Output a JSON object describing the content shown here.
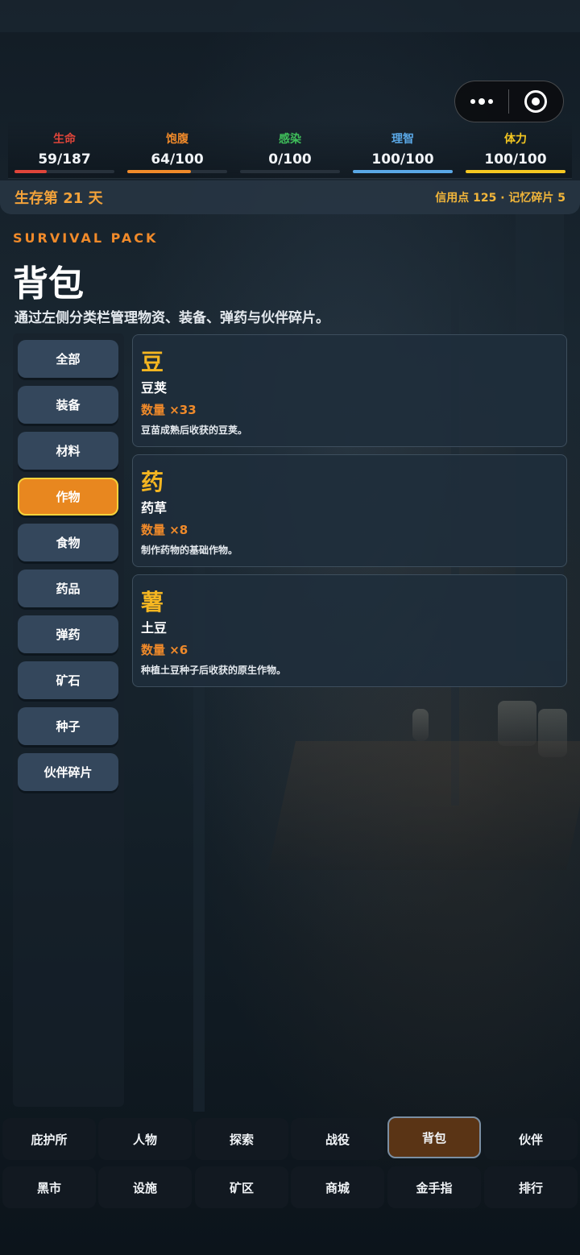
{
  "stats": [
    {
      "label": "生命",
      "value": "59/187",
      "color": "#e0453a",
      "fill": 0.32
    },
    {
      "label": "饱腹",
      "value": "64/100",
      "color": "#f08a2a",
      "fill": 0.64
    },
    {
      "label": "感染",
      "value": "0/100",
      "color": "#3fbf5a",
      "fill": 0.0
    },
    {
      "label": "理智",
      "value": "100/100",
      "color": "#5aa8e6",
      "fill": 1.0
    },
    {
      "label": "体力",
      "value": "100/100",
      "color": "#f5c821",
      "fill": 1.0
    }
  ],
  "status": {
    "day": "生存第 21 天",
    "resources": "信用点 125 · 记忆碎片 5"
  },
  "header": {
    "eyebrow": "SURVIVAL PACK",
    "title": "背包",
    "description": "通过左侧分类栏管理物资、装备、弹药与伙伴碎片。"
  },
  "categories": [
    {
      "label": "全部",
      "active": false
    },
    {
      "label": "装备",
      "active": false
    },
    {
      "label": "材料",
      "active": false
    },
    {
      "label": "作物",
      "active": true
    },
    {
      "label": "食物",
      "active": false
    },
    {
      "label": "药品",
      "active": false
    },
    {
      "label": "弹药",
      "active": false
    },
    {
      "label": "矿石",
      "active": false
    },
    {
      "label": "种子",
      "active": false
    },
    {
      "label": "伙伴碎片",
      "active": false
    }
  ],
  "items": [
    {
      "glyph": "豆",
      "name": "豆荚",
      "qty": "数量 ×33",
      "desc": "豆苗成熟后收获的豆荚。"
    },
    {
      "glyph": "药",
      "name": "药草",
      "qty": "数量 ×8",
      "desc": "制作药物的基础作物。"
    },
    {
      "glyph": "薯",
      "name": "土豆",
      "qty": "数量 ×6",
      "desc": "种植土豆种子后收获的原生作物。"
    }
  ],
  "nav": [
    {
      "label": "庇护所",
      "active": false
    },
    {
      "label": "人物",
      "active": false
    },
    {
      "label": "探索",
      "active": false
    },
    {
      "label": "战役",
      "active": false
    },
    {
      "label": "背包",
      "active": true
    },
    {
      "label": "伙伴",
      "active": false
    },
    {
      "label": "黑市",
      "active": false
    },
    {
      "label": "设施",
      "active": false
    },
    {
      "label": "矿区",
      "active": false
    },
    {
      "label": "商城",
      "active": false
    },
    {
      "label": "金手指",
      "active": false
    },
    {
      "label": "排行",
      "active": false
    }
  ],
  "capsule": {
    "more_icon": "more-dots-icon",
    "close_icon": "target-close-icon"
  }
}
